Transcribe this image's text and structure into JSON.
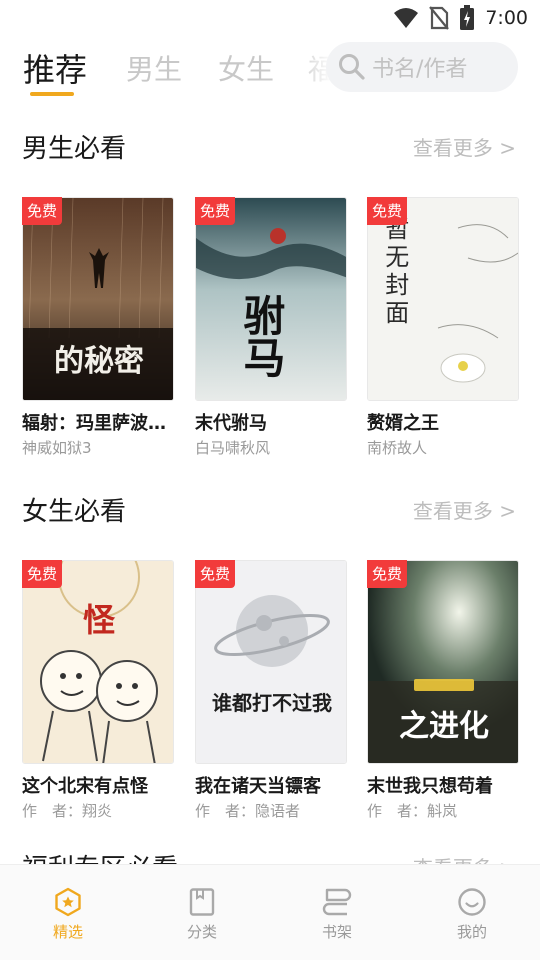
{
  "status_bar": {
    "time": "7:00"
  },
  "top_tabs": {
    "items": [
      "推荐",
      "男生",
      "女生",
      "福"
    ],
    "active": "推荐"
  },
  "search": {
    "placeholder": "书名/作者"
  },
  "sections": [
    {
      "title": "男生必看",
      "more": "查看更多 >",
      "books": [
        {
          "title": "辐射：玛里萨波…",
          "author": "神威如狱3",
          "badge": "免费",
          "cover_text": "的秘密"
        },
        {
          "title": "末代驸马",
          "author": "白马啸秋风",
          "badge": "免费",
          "cover_text": "驸马"
        },
        {
          "title": "赘婿之王",
          "author": "南桥故人",
          "badge": "免费",
          "cover_text": "暂无封面"
        }
      ]
    },
    {
      "title": "女生必看",
      "more": "查看更多 >",
      "books": [
        {
          "title": "这个北宋有点怪",
          "author": "作　者：翔炎",
          "badge": "免费",
          "cover_text": "怪"
        },
        {
          "title": "我在诸天当镖客",
          "author": "作　者：隐语者",
          "badge": "免费",
          "cover_text": "谁都打不过我"
        },
        {
          "title": "末世我只想苟着",
          "author": "作　者：斛岚",
          "badge": "免费",
          "cover_text": "之进化"
        }
      ]
    }
  ],
  "peek_section": {
    "title": "福利专区必看",
    "more": "查看更多 >"
  },
  "bottom_nav": [
    {
      "label": "精选",
      "icon": "featured-icon",
      "active": true
    },
    {
      "label": "分类",
      "icon": "category-icon",
      "active": false
    },
    {
      "label": "书架",
      "icon": "bookshelf-icon",
      "active": false
    },
    {
      "label": "我的",
      "icon": "profile-icon",
      "active": false
    }
  ],
  "colors": {
    "accent": "#f0a81e",
    "badge": "#f23b3b",
    "muted": "#bdbdbd"
  }
}
